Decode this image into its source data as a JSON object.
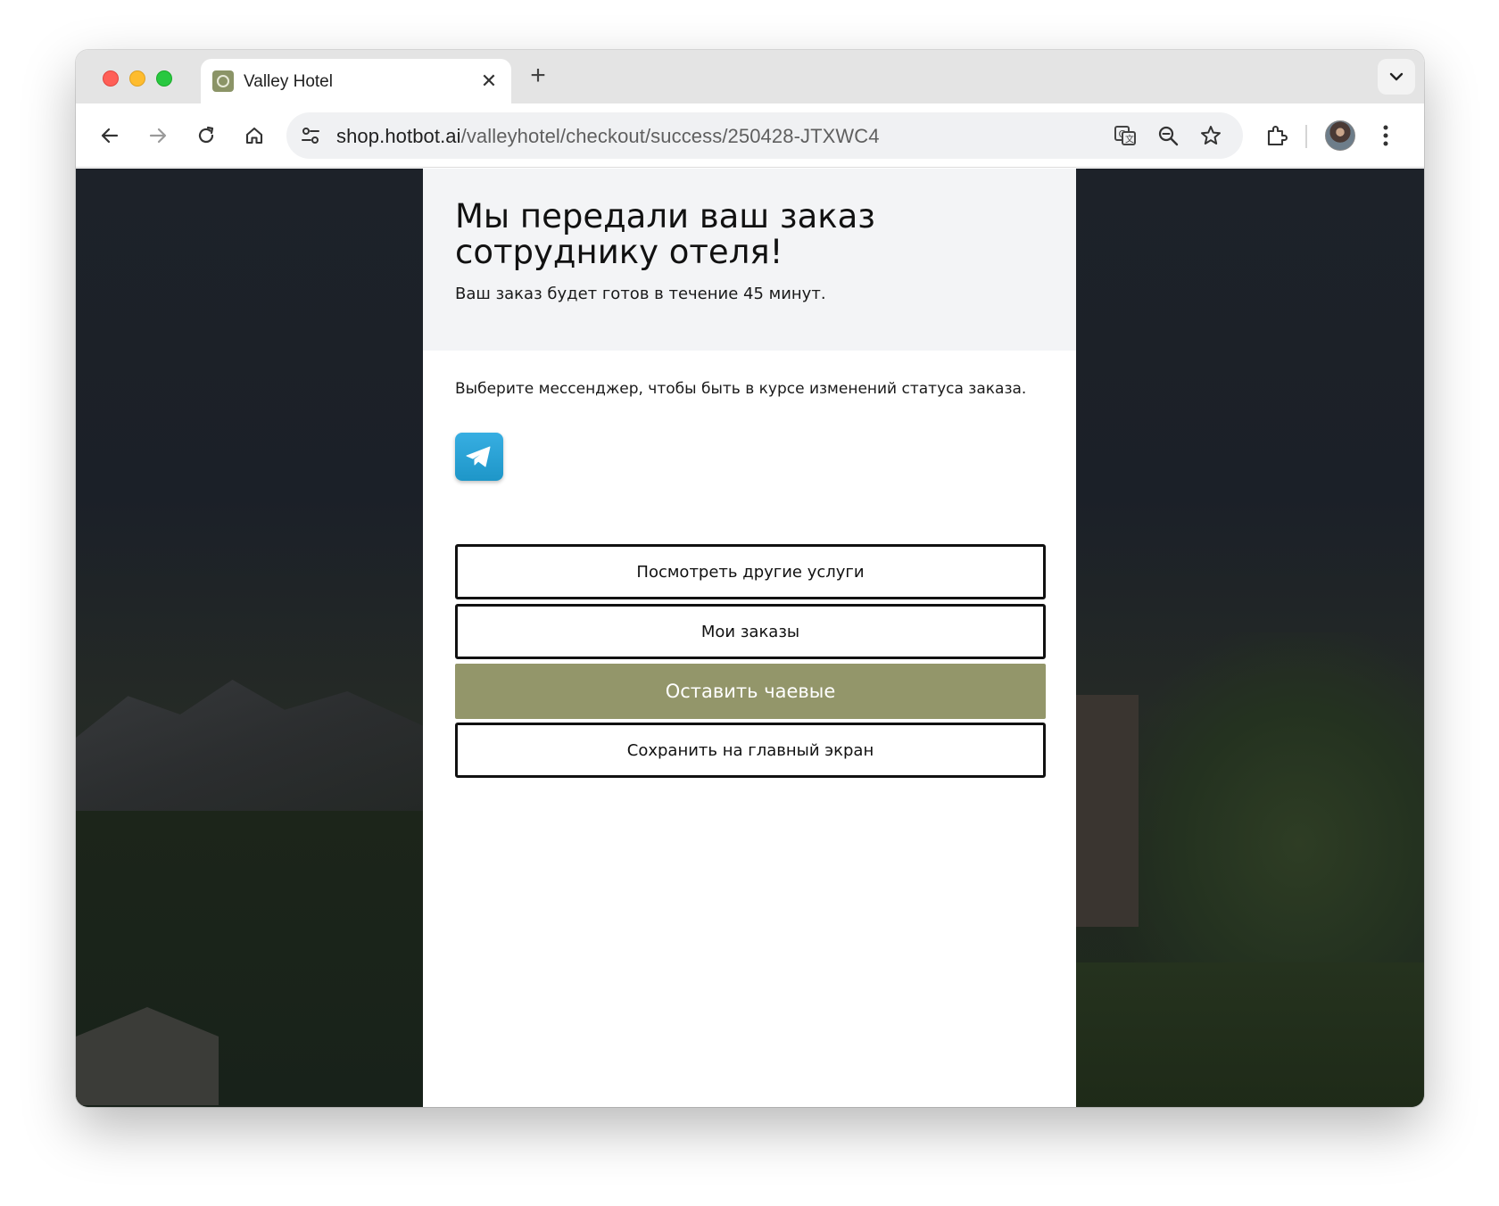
{
  "browser": {
    "tab": {
      "title": "Valley Hotel",
      "close_glyph": "✕"
    },
    "new_tab_glyph": "+",
    "url": {
      "host": "shop.hotbot.ai",
      "path": "/valleyhotel/checkout/success/250428-JTXWC4"
    },
    "icons": [
      "back-icon",
      "forward-icon",
      "reload-icon",
      "home-icon",
      "site-info-icon",
      "translate-icon",
      "zoom-icon",
      "bookmark-star-icon",
      "extensions-icon",
      "profile-avatar",
      "more-menu-icon",
      "tab-list-chevron-icon"
    ]
  },
  "page": {
    "heading": "Мы передали ваш заказ сотруднику отеля!",
    "subheading": "Ваш заказ будет готов в течение 45 минут.",
    "messenger_prompt": "Выберите мессенджер, чтобы быть в курсе изменений статуса заказа.",
    "messenger_icon": "telegram-icon",
    "buttons": {
      "other_services": "Посмотреть другие услуги",
      "my_orders": "Мои заказы",
      "leave_tip": "Оставить чаевые",
      "save_home": "Сохранить на главный экран"
    }
  },
  "colors": {
    "accent": "#93966a",
    "telegram": "#2aa3d8",
    "header_bg": "#f3f4f6"
  }
}
